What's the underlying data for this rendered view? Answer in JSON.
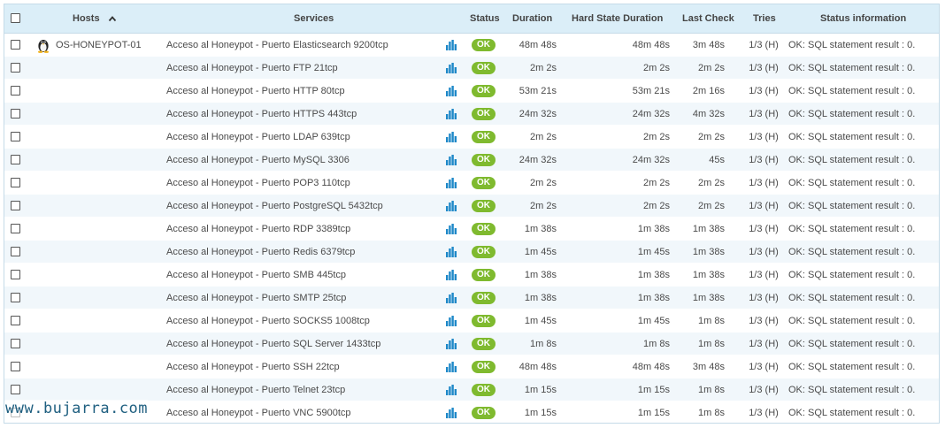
{
  "header": {
    "hosts": "Hosts",
    "sort_arrow": "^",
    "services": "Services",
    "status": "Status",
    "duration": "Duration",
    "hard_state_duration": "Hard State Duration",
    "last_check": "Last Check",
    "tries": "Tries",
    "status_information": "Status information"
  },
  "host": {
    "name": "OS-HONEYPOT-01",
    "icon": "linux-tux-icon"
  },
  "status_color": "#7fba2f",
  "rows": [
    {
      "service": "Acceso al Honeypot - Puerto Elasticsearch 9200tcp",
      "status": "OK",
      "duration": "48m 48s",
      "hard": "48m 48s",
      "last": "3m 48s",
      "tries": "1/3 (H)",
      "info": "OK: SQL statement result : 0."
    },
    {
      "service": "Acceso al Honeypot - Puerto FTP 21tcp",
      "status": "OK",
      "duration": "2m 2s",
      "hard": "2m 2s",
      "last": "2m 2s",
      "tries": "1/3 (H)",
      "info": "OK: SQL statement result : 0."
    },
    {
      "service": "Acceso al Honeypot - Puerto HTTP 80tcp",
      "status": "OK",
      "duration": "53m 21s",
      "hard": "53m 21s",
      "last": "2m 16s",
      "tries": "1/3 (H)",
      "info": "OK: SQL statement result : 0."
    },
    {
      "service": "Acceso al Honeypot - Puerto HTTPS 443tcp",
      "status": "OK",
      "duration": "24m 32s",
      "hard": "24m 32s",
      "last": "4m 32s",
      "tries": "1/3 (H)",
      "info": "OK: SQL statement result : 0."
    },
    {
      "service": "Acceso al Honeypot - Puerto LDAP 639tcp",
      "status": "OK",
      "duration": "2m 2s",
      "hard": "2m 2s",
      "last": "2m 2s",
      "tries": "1/3 (H)",
      "info": "OK: SQL statement result : 0."
    },
    {
      "service": "Acceso al Honeypot - Puerto MySQL 3306",
      "status": "OK",
      "duration": "24m 32s",
      "hard": "24m 32s",
      "last": "45s",
      "tries": "1/3 (H)",
      "info": "OK: SQL statement result : 0."
    },
    {
      "service": "Acceso al Honeypot - Puerto POP3 110tcp",
      "status": "OK",
      "duration": "2m 2s",
      "hard": "2m 2s",
      "last": "2m 2s",
      "tries": "1/3 (H)",
      "info": "OK: SQL statement result : 0."
    },
    {
      "service": "Acceso al Honeypot - Puerto PostgreSQL 5432tcp",
      "status": "OK",
      "duration": "2m 2s",
      "hard": "2m 2s",
      "last": "2m 2s",
      "tries": "1/3 (H)",
      "info": "OK: SQL statement result : 0."
    },
    {
      "service": "Acceso al Honeypot - Puerto RDP 3389tcp",
      "status": "OK",
      "duration": "1m 38s",
      "hard": "1m 38s",
      "last": "1m 38s",
      "tries": "1/3 (H)",
      "info": "OK: SQL statement result : 0."
    },
    {
      "service": "Acceso al Honeypot - Puerto Redis 6379tcp",
      "status": "OK",
      "duration": "1m 45s",
      "hard": "1m 45s",
      "last": "1m 38s",
      "tries": "1/3 (H)",
      "info": "OK: SQL statement result : 0."
    },
    {
      "service": "Acceso al Honeypot - Puerto SMB 445tcp",
      "status": "OK",
      "duration": "1m 38s",
      "hard": "1m 38s",
      "last": "1m 38s",
      "tries": "1/3 (H)",
      "info": "OK: SQL statement result : 0."
    },
    {
      "service": "Acceso al Honeypot - Puerto SMTP 25tcp",
      "status": "OK",
      "duration": "1m 38s",
      "hard": "1m 38s",
      "last": "1m 38s",
      "tries": "1/3 (H)",
      "info": "OK: SQL statement result : 0."
    },
    {
      "service": "Acceso al Honeypot - Puerto SOCKS5 1008tcp",
      "status": "OK",
      "duration": "1m 45s",
      "hard": "1m 45s",
      "last": "1m 8s",
      "tries": "1/3 (H)",
      "info": "OK: SQL statement result : 0."
    },
    {
      "service": "Acceso al Honeypot - Puerto SQL Server 1433tcp",
      "status": "OK",
      "duration": "1m 8s",
      "hard": "1m 8s",
      "last": "1m 8s",
      "tries": "1/3 (H)",
      "info": "OK: SQL statement result : 0."
    },
    {
      "service": "Acceso al Honeypot - Puerto SSH 22tcp",
      "status": "OK",
      "duration": "48m 48s",
      "hard": "48m 48s",
      "last": "3m 48s",
      "tries": "1/3 (H)",
      "info": "OK: SQL statement result : 0."
    },
    {
      "service": "Acceso al Honeypot - Puerto Telnet 23tcp",
      "status": "OK",
      "duration": "1m 15s",
      "hard": "1m 15s",
      "last": "1m 8s",
      "tries": "1/3 (H)",
      "info": "OK: SQL statement result : 0."
    },
    {
      "service": "Acceso al Honeypot - Puerto VNC 5900tcp",
      "status": "OK",
      "duration": "1m 15s",
      "hard": "1m 15s",
      "last": "1m 8s",
      "tries": "1/3 (H)",
      "info": "OK: SQL statement result : 0."
    }
  ],
  "watermark": "www.bujarra.com"
}
